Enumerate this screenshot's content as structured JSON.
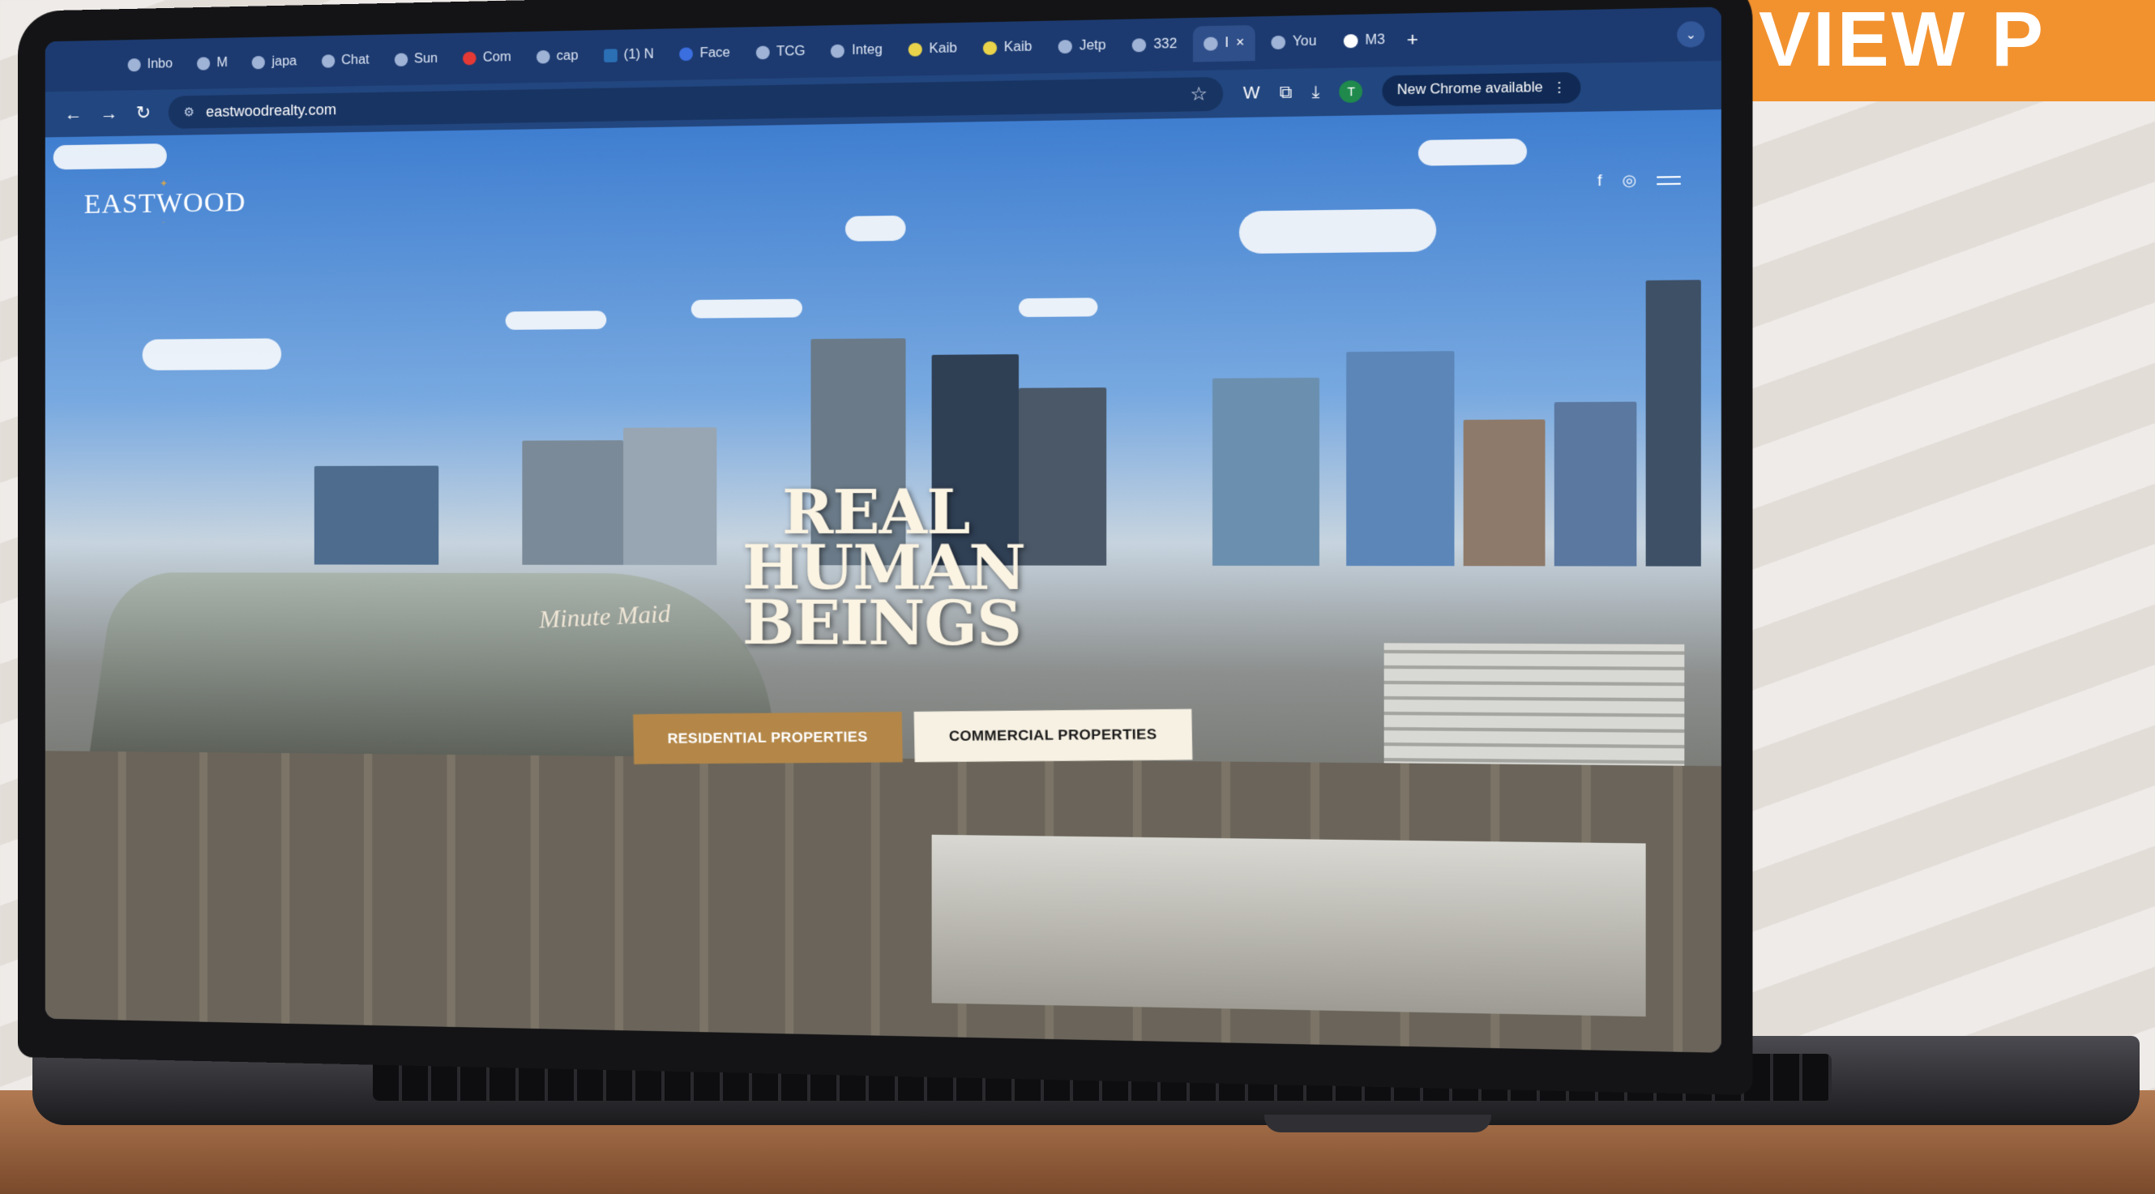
{
  "promo": {
    "badge_text": "VIEW P"
  },
  "browser": {
    "tabs": [
      {
        "label": "Inbo",
        "icon": "gmail-icon"
      },
      {
        "label": "M",
        "icon": "app-icon"
      },
      {
        "label": "japa",
        "icon": "globe-icon"
      },
      {
        "label": "Chat",
        "icon": "chatgpt-icon"
      },
      {
        "label": "Sun",
        "icon": "app-icon"
      },
      {
        "label": "Com",
        "icon": "youtube-icon"
      },
      {
        "label": "cap",
        "icon": "app-icon"
      },
      {
        "label": "(1) N",
        "icon": "linkedin-icon"
      },
      {
        "label": "Face",
        "icon": "facebook-icon"
      },
      {
        "label": "TCG",
        "icon": "app-icon"
      },
      {
        "label": "Integ",
        "icon": "app-icon"
      },
      {
        "label": "Kaib",
        "icon": "app-icon"
      },
      {
        "label": "Kaib",
        "icon": "app-icon"
      },
      {
        "label": "Jetp",
        "icon": "wordpress-icon"
      },
      {
        "label": "332",
        "icon": "app-icon"
      },
      {
        "label": "I",
        "icon": "app-icon",
        "active": true
      },
      {
        "label": "You",
        "icon": "app-icon"
      },
      {
        "label": "M3",
        "icon": "app-icon"
      }
    ],
    "tab_close": "×",
    "new_tab": "+",
    "tab_dropdown": "⌄",
    "url": "eastwoodrealty.com",
    "nav_back": "←",
    "nav_forward": "→",
    "nav_reload": "↻",
    "omnibox_tune": "⚙",
    "bookmark_star": "☆",
    "toolbar_ext": "W",
    "toolbar_puzzle": "⧉",
    "toolbar_download": "⤓",
    "profile_initial": "T",
    "new_chrome_label": "New Chrome available",
    "kebab": "⋮"
  },
  "site": {
    "logo": {
      "name": "EASTWOOD"
    },
    "social": {
      "facebook": "f",
      "instagram": "◎"
    },
    "hero": {
      "headline_lines": [
        "REAL",
        "HUMAN",
        "BEINGS"
      ],
      "stadium_sign": "Minute Maid"
    },
    "cta": {
      "residential": "RESIDENTIAL PROPERTIES",
      "commercial": "COMMERCIAL PROPERTIES"
    }
  }
}
